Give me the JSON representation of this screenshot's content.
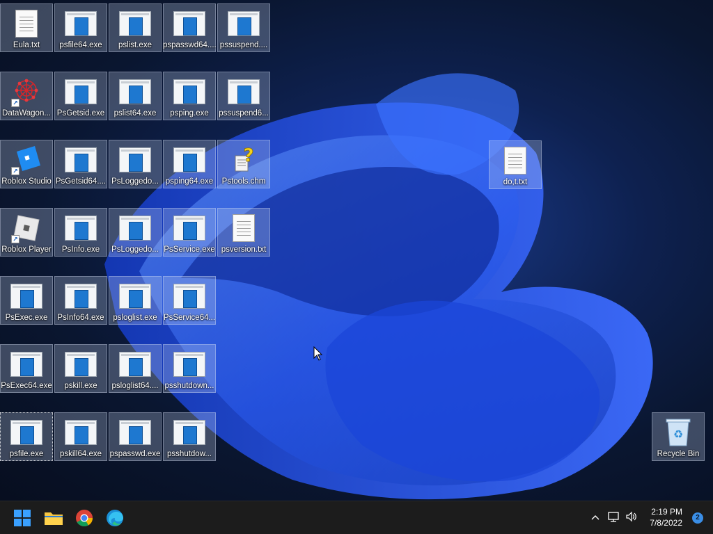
{
  "desktop": {
    "icons": [
      {
        "label": "Eula.txt",
        "type": "txt"
      },
      {
        "label": "psfile64.exe",
        "type": "exe"
      },
      {
        "label": "pslist.exe",
        "type": "exe"
      },
      {
        "label": "pspasswd64....",
        "type": "exe"
      },
      {
        "label": "pssuspend....",
        "type": "exe"
      },
      {
        "label": "DataWagon...",
        "type": "datawagon"
      },
      {
        "label": "PsGetsid.exe",
        "type": "exe"
      },
      {
        "label": "pslist64.exe",
        "type": "exe"
      },
      {
        "label": "psping.exe",
        "type": "exe"
      },
      {
        "label": "pssuspend6...",
        "type": "exe"
      },
      {
        "label": "Roblox Studio",
        "type": "roblox-studio"
      },
      {
        "label": "PsGetsid64....",
        "type": "exe"
      },
      {
        "label": "PsLoggedo...",
        "type": "exe"
      },
      {
        "label": "psping64.exe",
        "type": "exe"
      },
      {
        "label": "Pstools.chm",
        "type": "chm"
      },
      {
        "label": "Roblox Player",
        "type": "roblox-player"
      },
      {
        "label": "PsInfo.exe",
        "type": "exe"
      },
      {
        "label": "PsLoggedo...",
        "type": "exe"
      },
      {
        "label": "PsService.exe",
        "type": "exe"
      },
      {
        "label": "psversion.txt",
        "type": "txt"
      },
      {
        "label": "PsExec.exe",
        "type": "exe"
      },
      {
        "label": "PsInfo64.exe",
        "type": "exe"
      },
      {
        "label": "psloglist.exe",
        "type": "exe"
      },
      {
        "label": "PsService64...",
        "type": "exe"
      },
      {
        "label": "PsExec64.exe",
        "type": "exe"
      },
      {
        "label": "pskill.exe",
        "type": "exe"
      },
      {
        "label": "psloglist64....",
        "type": "exe"
      },
      {
        "label": "psshutdown...",
        "type": "exe"
      },
      {
        "label": "psfile.exe",
        "type": "exe"
      },
      {
        "label": "pskill64.exe",
        "type": "exe"
      },
      {
        "label": "pspasswd.exe",
        "type": "exe"
      },
      {
        "label": "psshutdow...",
        "type": "exe"
      }
    ],
    "doc_icon": {
      "label": "do,t.txt"
    },
    "recycle_bin": {
      "label": "Recycle Bin"
    }
  },
  "taskbar": {
    "apps": [
      {
        "name": "start-button"
      },
      {
        "name": "file-explorer-icon"
      },
      {
        "name": "chrome-icon"
      },
      {
        "name": "edge-icon"
      }
    ],
    "clock": {
      "time": "2:19 PM",
      "date": "7/8/2022"
    },
    "notifications": {
      "count": "2"
    }
  },
  "colors": {
    "accent": "#1e78d0",
    "taskbar": "#1c1c1c"
  }
}
